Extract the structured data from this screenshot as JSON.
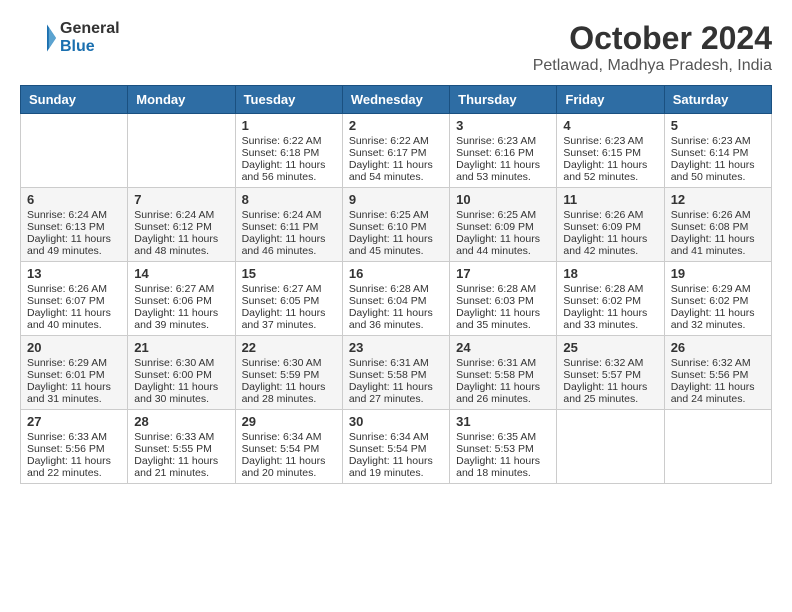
{
  "header": {
    "logo_line1": "General",
    "logo_line2": "Blue",
    "title": "October 2024",
    "subtitle": "Petlawad, Madhya Pradesh, India"
  },
  "calendar": {
    "headers": [
      "Sunday",
      "Monday",
      "Tuesday",
      "Wednesday",
      "Thursday",
      "Friday",
      "Saturday"
    ],
    "rows": [
      [
        {
          "day": "",
          "data": ""
        },
        {
          "day": "",
          "data": ""
        },
        {
          "day": "1",
          "data": "Sunrise: 6:22 AM\nSunset: 6:18 PM\nDaylight: 11 hours and 56 minutes."
        },
        {
          "day": "2",
          "data": "Sunrise: 6:22 AM\nSunset: 6:17 PM\nDaylight: 11 hours and 54 minutes."
        },
        {
          "day": "3",
          "data": "Sunrise: 6:23 AM\nSunset: 6:16 PM\nDaylight: 11 hours and 53 minutes."
        },
        {
          "day": "4",
          "data": "Sunrise: 6:23 AM\nSunset: 6:15 PM\nDaylight: 11 hours and 52 minutes."
        },
        {
          "day": "5",
          "data": "Sunrise: 6:23 AM\nSunset: 6:14 PM\nDaylight: 11 hours and 50 minutes."
        }
      ],
      [
        {
          "day": "6",
          "data": "Sunrise: 6:24 AM\nSunset: 6:13 PM\nDaylight: 11 hours and 49 minutes."
        },
        {
          "day": "7",
          "data": "Sunrise: 6:24 AM\nSunset: 6:12 PM\nDaylight: 11 hours and 48 minutes."
        },
        {
          "day": "8",
          "data": "Sunrise: 6:24 AM\nSunset: 6:11 PM\nDaylight: 11 hours and 46 minutes."
        },
        {
          "day": "9",
          "data": "Sunrise: 6:25 AM\nSunset: 6:10 PM\nDaylight: 11 hours and 45 minutes."
        },
        {
          "day": "10",
          "data": "Sunrise: 6:25 AM\nSunset: 6:09 PM\nDaylight: 11 hours and 44 minutes."
        },
        {
          "day": "11",
          "data": "Sunrise: 6:26 AM\nSunset: 6:09 PM\nDaylight: 11 hours and 42 minutes."
        },
        {
          "day": "12",
          "data": "Sunrise: 6:26 AM\nSunset: 6:08 PM\nDaylight: 11 hours and 41 minutes."
        }
      ],
      [
        {
          "day": "13",
          "data": "Sunrise: 6:26 AM\nSunset: 6:07 PM\nDaylight: 11 hours and 40 minutes."
        },
        {
          "day": "14",
          "data": "Sunrise: 6:27 AM\nSunset: 6:06 PM\nDaylight: 11 hours and 39 minutes."
        },
        {
          "day": "15",
          "data": "Sunrise: 6:27 AM\nSunset: 6:05 PM\nDaylight: 11 hours and 37 minutes."
        },
        {
          "day": "16",
          "data": "Sunrise: 6:28 AM\nSunset: 6:04 PM\nDaylight: 11 hours and 36 minutes."
        },
        {
          "day": "17",
          "data": "Sunrise: 6:28 AM\nSunset: 6:03 PM\nDaylight: 11 hours and 35 minutes."
        },
        {
          "day": "18",
          "data": "Sunrise: 6:28 AM\nSunset: 6:02 PM\nDaylight: 11 hours and 33 minutes."
        },
        {
          "day": "19",
          "data": "Sunrise: 6:29 AM\nSunset: 6:02 PM\nDaylight: 11 hours and 32 minutes."
        }
      ],
      [
        {
          "day": "20",
          "data": "Sunrise: 6:29 AM\nSunset: 6:01 PM\nDaylight: 11 hours and 31 minutes."
        },
        {
          "day": "21",
          "data": "Sunrise: 6:30 AM\nSunset: 6:00 PM\nDaylight: 11 hours and 30 minutes."
        },
        {
          "day": "22",
          "data": "Sunrise: 6:30 AM\nSunset: 5:59 PM\nDaylight: 11 hours and 28 minutes."
        },
        {
          "day": "23",
          "data": "Sunrise: 6:31 AM\nSunset: 5:58 PM\nDaylight: 11 hours and 27 minutes."
        },
        {
          "day": "24",
          "data": "Sunrise: 6:31 AM\nSunset: 5:58 PM\nDaylight: 11 hours and 26 minutes."
        },
        {
          "day": "25",
          "data": "Sunrise: 6:32 AM\nSunset: 5:57 PM\nDaylight: 11 hours and 25 minutes."
        },
        {
          "day": "26",
          "data": "Sunrise: 6:32 AM\nSunset: 5:56 PM\nDaylight: 11 hours and 24 minutes."
        }
      ],
      [
        {
          "day": "27",
          "data": "Sunrise: 6:33 AM\nSunset: 5:56 PM\nDaylight: 11 hours and 22 minutes."
        },
        {
          "day": "28",
          "data": "Sunrise: 6:33 AM\nSunset: 5:55 PM\nDaylight: 11 hours and 21 minutes."
        },
        {
          "day": "29",
          "data": "Sunrise: 6:34 AM\nSunset: 5:54 PM\nDaylight: 11 hours and 20 minutes."
        },
        {
          "day": "30",
          "data": "Sunrise: 6:34 AM\nSunset: 5:54 PM\nDaylight: 11 hours and 19 minutes."
        },
        {
          "day": "31",
          "data": "Sunrise: 6:35 AM\nSunset: 5:53 PM\nDaylight: 11 hours and 18 minutes."
        },
        {
          "day": "",
          "data": ""
        },
        {
          "day": "",
          "data": ""
        }
      ]
    ]
  }
}
